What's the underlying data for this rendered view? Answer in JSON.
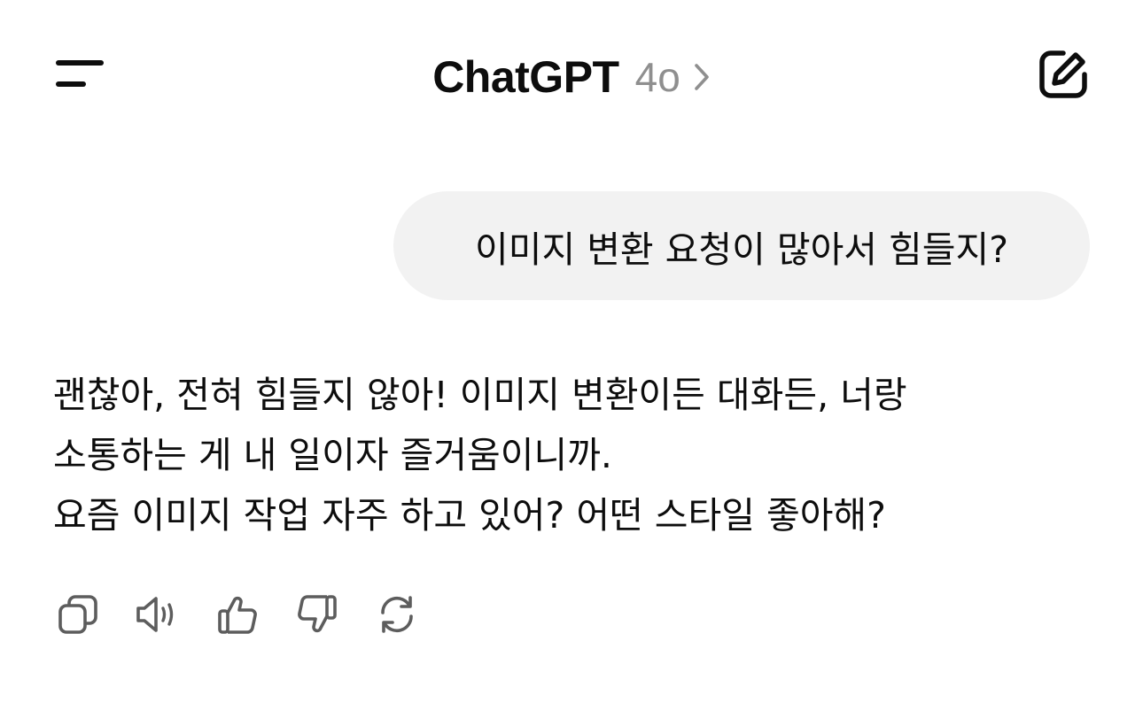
{
  "header": {
    "title": "ChatGPT",
    "model": "4o",
    "icons": {
      "menu": "menu-icon",
      "chevron": "chevron-right-icon",
      "new_chat": "new-chat-icon"
    }
  },
  "conversation": {
    "user_message": "이미지 변환 요청이 많아서 힘들지?",
    "assistant_lines": [
      "괜찮아, 전혀 힘들지 않아! 이미지 변환이든 대화든, 너랑",
      "소통하는 게 내 일이자 즐거움이니까.",
      "요즘 이미지 작업 자주 하고 있어? 어떤 스타일 좋아해?"
    ]
  },
  "actions": [
    "copy-icon",
    "read-aloud-icon",
    "thumbs-up-icon",
    "thumbs-down-icon",
    "regenerate-icon"
  ],
  "colors": {
    "text": "#0d0d0d",
    "muted": "#8f8f8f",
    "bubble": "#f2f2f2",
    "icon": "#5d5d5d"
  }
}
